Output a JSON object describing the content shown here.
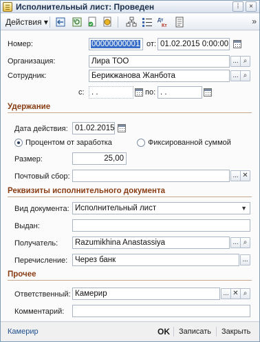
{
  "window": {
    "title": "Исполнительный лист: Проведен",
    "btn_more": "⁞",
    "btn_close": "×"
  },
  "toolbar": {
    "actions_label": "Действия",
    "more": "»",
    "icons": [
      "arrow-back-icon",
      "refresh-doc-icon",
      "post-doc-icon",
      "unpost-doc-icon",
      "structure-icon",
      "list-icon",
      "dt-kt-icon",
      "print-doc-icon"
    ]
  },
  "header": {
    "number_label": "Номер:",
    "number_value": "00000000001",
    "from_label": "от:",
    "date_value": "01.02.2015  0:00:00",
    "org_label": "Организация:",
    "org_value": "Лира ТОО",
    "employee_label": "Сотрудник:",
    "employee_value": "Берикжанова Жанбота",
    "period_from_label": "с:",
    "period_from_value": "  .  .",
    "period_to_label": "по:",
    "period_to_value": "  .  ."
  },
  "deduction": {
    "section_title": "Удержание",
    "action_date_label": "Дата действия:",
    "action_date_value": "01.02.2015",
    "radio_percent_label": "Процентом от заработка",
    "radio_fixed_label": "Фиксированной суммой",
    "size_label": "Размер:",
    "size_value": "25,00",
    "postal_fee_label": "Почтовый сбор:",
    "postal_fee_value": ""
  },
  "requisites": {
    "section_title": "Реквизиты исполнительного документа",
    "doc_type_label": "Вид документа:",
    "doc_type_value": "Исполнительный лист",
    "issued_label": "Выдан:",
    "issued_value": "",
    "recipient_label": "Получатель:",
    "recipient_value": "Razumikhina Anastassiya",
    "transfer_label": "Перечисление:",
    "transfer_value": "Через банк"
  },
  "other": {
    "section_title": "Прочее",
    "responsible_label": "Ответственный:",
    "responsible_value": "Камерир",
    "comment_label": "Комментарий:",
    "comment_value": ""
  },
  "statusbar": {
    "user": "Камерир",
    "ok": "OK",
    "save": "Записать",
    "close": "Закрыть"
  },
  "glyphs": {
    "ellipsis": "...",
    "search": "⌕",
    "clear": "✕",
    "dropdown": "▼",
    "dropdown_small": "▾"
  },
  "colors": {
    "section_title": "#8a3d14",
    "link": "#1f4f8f",
    "selection": "#3a6fc9"
  }
}
